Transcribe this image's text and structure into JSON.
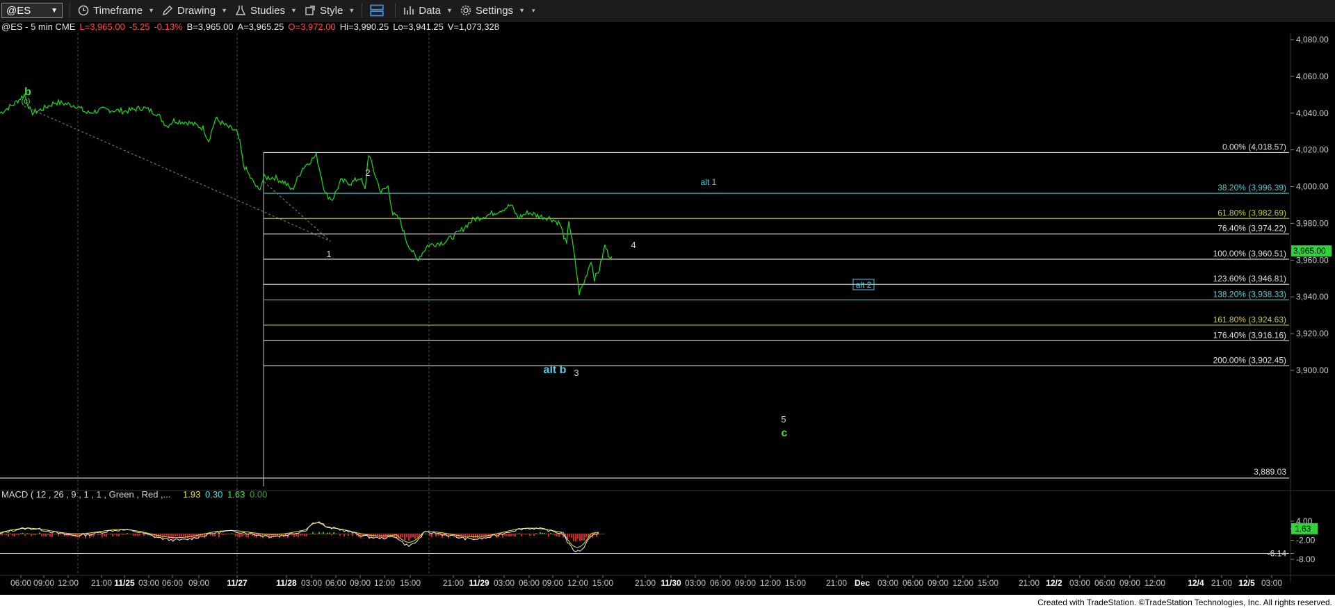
{
  "toolbar": {
    "symbol": "@ES",
    "items": [
      {
        "label": "Timeframe",
        "icon": "clock-icon"
      },
      {
        "label": "Drawing",
        "icon": "pencil-icon"
      },
      {
        "label": "Studies",
        "icon": "flask-icon"
      },
      {
        "label": "Style",
        "icon": "style-icon"
      },
      {
        "label": "",
        "icon": "layout-icon"
      },
      {
        "label": "Data",
        "icon": "bar-chart-icon"
      },
      {
        "label": "Settings",
        "icon": "gear-icon"
      }
    ]
  },
  "infobar": {
    "symbol_info": "@ES - 5 min  CME",
    "last": "L=3,965.00",
    "change": "-5.25",
    "pct": "-0.13%",
    "bid": "B=3,965.00",
    "ask": "A=3,965.25",
    "open": "O=3,972.00",
    "high": "Hi=3,990.25",
    "low": "Lo=3,941.25",
    "volume": "V=1,073,328"
  },
  "colors": {
    "price": "#22cc22",
    "fib_white": "#c8c8c8",
    "fib_teal": "#3fa7a7",
    "fib_olive": "#b0b040",
    "label_teal": "#5ec8c8",
    "label_olive": "#c8c850",
    "wave_white": "#d8d8d8",
    "wave_green": "#44dd44",
    "wave_cyan": "#55ccee"
  },
  "chart_data": {
    "type": "line",
    "title": "@ES - 5 min CME",
    "ylim": [
      3880,
      4085
    ],
    "y_ticks": [
      "4,080.00",
      "4,060.00",
      "4,040.00",
      "4,020.00",
      "4,000.00",
      "3,980.00",
      "3,960.00",
      "3,940.00",
      "3,920.00",
      "3,900.00"
    ],
    "last_price_label": "3,965.00",
    "low_label": "3,889.03",
    "x_tick_labels": [
      "06:00",
      "09:00",
      "12:00",
      "21:00",
      "11/25",
      "03:00",
      "06:00",
      "09:00",
      "11/27",
      "11/28",
      "03:00",
      "06:00",
      "09:00",
      "12:00",
      "15:00",
      "21:00",
      "11/29",
      "03:00",
      "06:00",
      "09:00",
      "12:00",
      "15:00",
      "21:00",
      "11/30",
      "03:00",
      "06:00",
      "09:00",
      "12:00",
      "15:00",
      "21:00",
      "Dec",
      "03:00",
      "06:00",
      "09:00",
      "12:00",
      "15:00",
      "21:00",
      "12/2",
      "03:00",
      "06:00",
      "09:00",
      "12:00",
      "12/4",
      "21:00",
      "12/5",
      "03:00"
    ],
    "fib_levels": [
      {
        "label": "0.00% (4,018.57)",
        "value": 4018.57,
        "tone": "white"
      },
      {
        "label": "38.20% (3,996.39)",
        "value": 3996.39,
        "tone": "teal"
      },
      {
        "label": "61.80% (3,982.69)",
        "value": 3982.69,
        "tone": "olive"
      },
      {
        "label": "76.40% (3,974.22)",
        "value": 3974.22,
        "tone": "white"
      },
      {
        "label": "100.00% (3,960.51)",
        "value": 3960.51,
        "tone": "white"
      },
      {
        "label": "123.60% (3,946.81)",
        "value": 3946.81,
        "tone": "white"
      },
      {
        "label": "138.20% (3,938.33)",
        "value": 3938.33,
        "tone": "teal"
      },
      {
        "label": "161.80% (3,924.63)",
        "value": 3924.63,
        "tone": "olive"
      },
      {
        "label": "176.40% (3,916.16)",
        "value": 3916.16,
        "tone": "white"
      },
      {
        "label": "200.00% (3,902.45)",
        "value": 3902.45,
        "tone": "white"
      }
    ],
    "wave_labels": [
      {
        "text": "b",
        "style": "green",
        "value": 4054
      },
      {
        "text": "(c)",
        "style": "green-small",
        "value": 4050
      },
      {
        "text": "2",
        "style": "white",
        "value": 4020
      },
      {
        "text": "1",
        "style": "white",
        "value": 3989
      },
      {
        "text": "4",
        "style": "white",
        "value": 3984
      },
      {
        "text": "alt 1",
        "style": "cyan",
        "value": 4016
      },
      {
        "text": "alt 2",
        "style": "cyan-box",
        "value": 3971
      },
      {
        "text": "alt b",
        "style": "cyan-bold",
        "value": 3937
      },
      {
        "text": "3",
        "style": "white",
        "value": 3936
      },
      {
        "text": "5",
        "style": "white",
        "value": 3914
      },
      {
        "text": "c",
        "style": "green",
        "value": 3909
      }
    ],
    "macd": {
      "label": "MACD ( 12 , 26 , 9 , 1 , 1 , Green , Red ,...",
      "values": [
        "1.93",
        "0.30",
        "1.63",
        "0.00"
      ],
      "y_ticks": [
        "4.00",
        "1.63",
        "-2.00",
        "-6.14",
        "-8.00"
      ]
    }
  },
  "footer": {
    "credit": "Created with TradeStation. ©TradeStation Technologies, Inc. All rights reserved."
  }
}
